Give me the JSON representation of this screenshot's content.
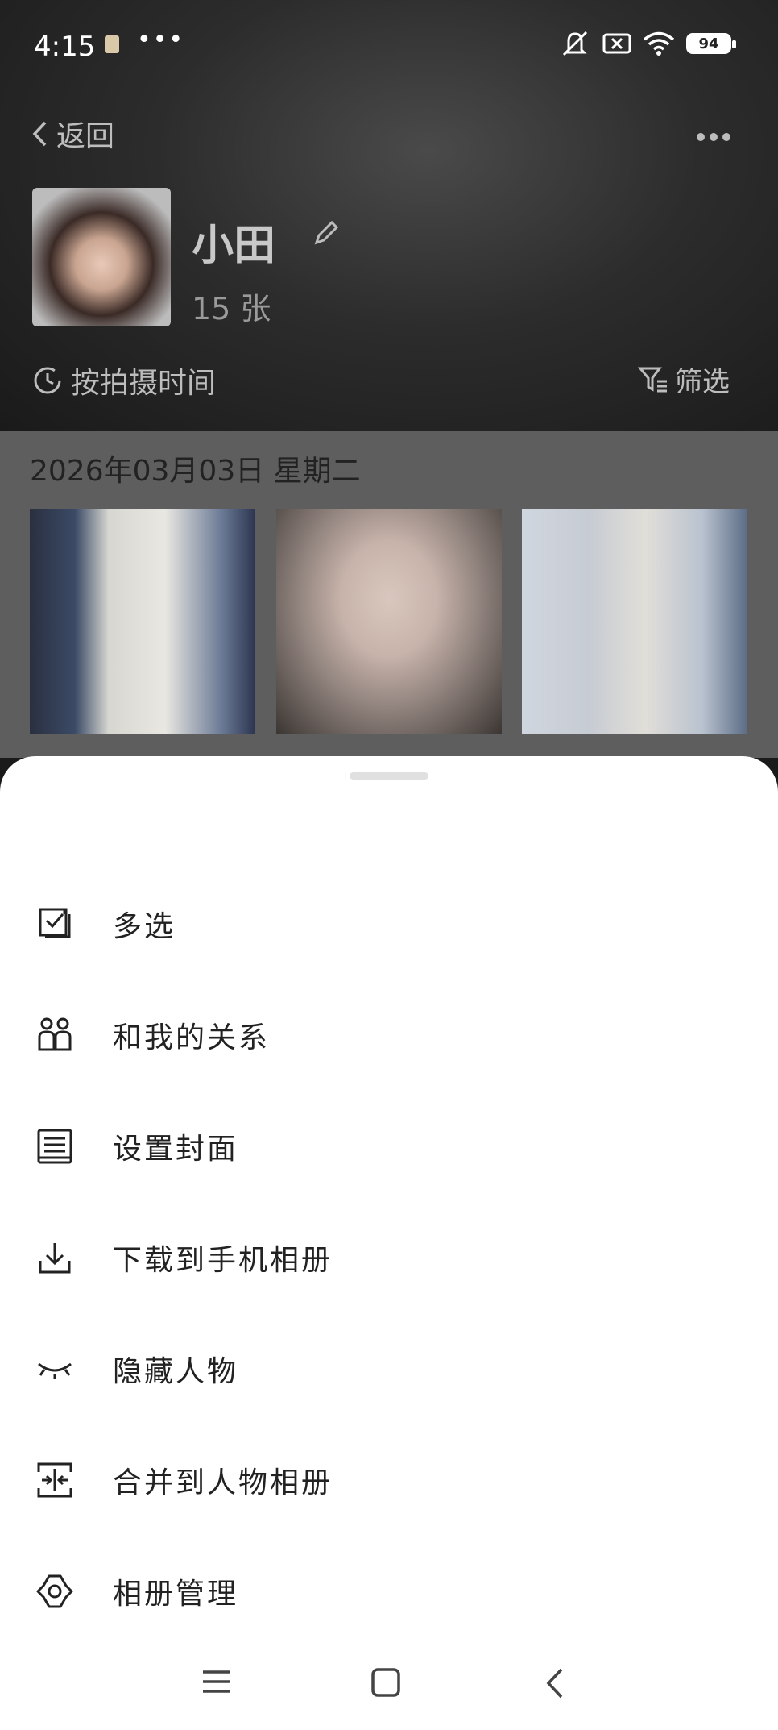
{
  "status_bar": {
    "time": "4:15",
    "battery": "94"
  },
  "header": {
    "back_label": "返回",
    "name": "小田",
    "count": "15 张",
    "sort_label": "按拍摄时间",
    "filter_label": "筛选"
  },
  "content": {
    "date_label": "2026年03月03日 星期二"
  },
  "menu": {
    "items": [
      {
        "label": "多选",
        "icon": "multi-select-icon"
      },
      {
        "label": "和我的关系",
        "icon": "people-icon"
      },
      {
        "label": "设置封面",
        "icon": "cover-icon"
      },
      {
        "label": "下载到手机相册",
        "icon": "download-icon"
      },
      {
        "label": "隐藏人物",
        "icon": "eye-closed-icon"
      },
      {
        "label": "合并到人物相册",
        "icon": "merge-icon"
      },
      {
        "label": "相册管理",
        "icon": "gear-icon"
      }
    ]
  }
}
